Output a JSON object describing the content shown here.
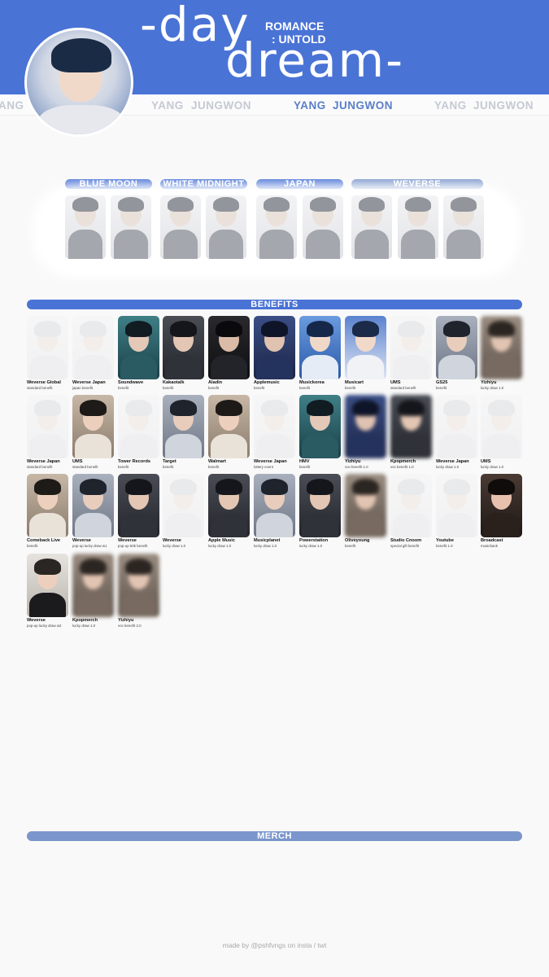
{
  "header": {
    "title_line1": "-day",
    "title_line2": "dream-",
    "subtitle_line1": "ROMANCE",
    "subtitle_line2": ": UNTOLD",
    "band_color": "#4a73d6"
  },
  "name_strip": [
    {
      "text": "ANG",
      "style": "faded"
    },
    {
      "text": "YANG",
      "style": "faded"
    },
    {
      "text": "JUNGWON",
      "style": "faded"
    },
    {
      "text": "YANG",
      "style": "strong"
    },
    {
      "text": "JUNGWON",
      "style": "strong"
    },
    {
      "text": "YANG",
      "style": "faded"
    },
    {
      "text": "JUNGWON",
      "style": "faded"
    }
  ],
  "versions": [
    {
      "label": "BLUE MOON",
      "color": "#4a73d6"
    },
    {
      "label": "WHITE MIDNIGHT",
      "color": "#4a73d6"
    },
    {
      "label": "JAPAN",
      "color": "#4a73d6"
    },
    {
      "label": "WEVERSE",
      "color": "#7b96cc"
    }
  ],
  "sections": {
    "benefits": "BENEFITS",
    "merch": "MERCH"
  },
  "benefits": [
    {
      "store": "Weverse Global",
      "kind": "standard benefit",
      "tone": "light",
      "fx": "faded"
    },
    {
      "store": "Weverse Japan",
      "kind": "japan benefit",
      "tone": "light",
      "fx": "faded"
    },
    {
      "store": "Soundwave",
      "kind": "benefit",
      "tone": "teal",
      "fx": ""
    },
    {
      "store": "Kakaotalk",
      "kind": "benefit",
      "tone": "dark",
      "fx": ""
    },
    {
      "store": "Aladin",
      "kind": "benefit",
      "tone": "film",
      "fx": ""
    },
    {
      "store": "Applemusic",
      "kind": "benefit",
      "tone": "navy",
      "fx": ""
    },
    {
      "store": "Musickorea",
      "kind": "benefit",
      "tone": "bluebright",
      "fx": ""
    },
    {
      "store": "Musicart",
      "kind": "benefit",
      "tone": "blue",
      "fx": ""
    },
    {
      "store": "UMS",
      "kind": "standard benefit",
      "tone": "light",
      "fx": "faded"
    },
    {
      "store": "GS25",
      "kind": "benefit",
      "tone": "grey",
      "fx": ""
    },
    {
      "store": "Yizhiyu",
      "kind": "lucky draw 1.0",
      "tone": "sepia",
      "fx": "blur"
    },
    {
      "store": "Weverse Japan",
      "kind": "standard benefit",
      "tone": "light",
      "fx": "faded"
    },
    {
      "store": "UMS",
      "kind": "standard benefit",
      "tone": "warm",
      "fx": ""
    },
    {
      "store": "Tower Records",
      "kind": "benefit",
      "tone": "light",
      "fx": "faded"
    },
    {
      "store": "Target",
      "kind": "benefit",
      "tone": "grey",
      "fx": ""
    },
    {
      "store": "Walmart",
      "kind": "benefit",
      "tone": "warm",
      "fx": ""
    },
    {
      "store": "Weverse Japan",
      "kind": "lottery event",
      "tone": "light",
      "fx": "faded"
    },
    {
      "store": "HMV",
      "kind": "benefit",
      "tone": "teal",
      "fx": ""
    },
    {
      "store": "Yizhiyu",
      "kind": "vce benefit 1.0",
      "tone": "navy",
      "fx": "blur"
    },
    {
      "store": "Kpopmerch",
      "kind": "vce benefit 1.0",
      "tone": "dark",
      "fx": "blur"
    },
    {
      "store": "Weverse Japan",
      "kind": "lucky draw 1.0",
      "tone": "light",
      "fx": "faded"
    },
    {
      "store": "UMS",
      "kind": "lucky draw 1.0",
      "tone": "light",
      "fx": "faded"
    },
    {
      "store": "Comeback Live",
      "kind": "benefit",
      "tone": "warm",
      "fx": ""
    },
    {
      "store": "Weverse",
      "kind": "pop-up lucky draw w1",
      "tone": "grey",
      "fx": ""
    },
    {
      "store": "Weverse",
      "kind": "pop-up 50k benefit",
      "tone": "dark",
      "fx": ""
    },
    {
      "store": "Weverse",
      "kind": "lucky draw 1.0",
      "tone": "light",
      "fx": "faded"
    },
    {
      "store": "Apple Music",
      "kind": "lucky draw 1.0",
      "tone": "dark",
      "fx": ""
    },
    {
      "store": "Musicplanet",
      "kind": "lucky draw 1.0",
      "tone": "grey",
      "fx": ""
    },
    {
      "store": "Powerstation",
      "kind": "lucky draw 1.0",
      "tone": "dark",
      "fx": ""
    },
    {
      "store": "Oliveyoung",
      "kind": "benefit",
      "tone": "sepia",
      "fx": "blur"
    },
    {
      "store": "Studio Cnoom",
      "kind": "special gift benefit",
      "tone": "light",
      "fx": "faded"
    },
    {
      "store": "Youtube",
      "kind": "benefit 1.0",
      "tone": "light",
      "fx": "faded"
    },
    {
      "store": "Broadcast",
      "kind": "musicbank",
      "tone": "warmclose",
      "fx": ""
    },
    {
      "store": "Weverse",
      "kind": "pop-up lucky draw w2",
      "tone": "suit",
      "fx": ""
    },
    {
      "store": "Kpopmerch",
      "kind": "lucky draw 1.0",
      "tone": "sepia",
      "fx": "blur"
    },
    {
      "store": "Yizhiyu",
      "kind": "vce benefit 2.0",
      "tone": "sepia",
      "fx": "blur"
    }
  ],
  "credit": "made by @pshfvngs on insta / twt"
}
